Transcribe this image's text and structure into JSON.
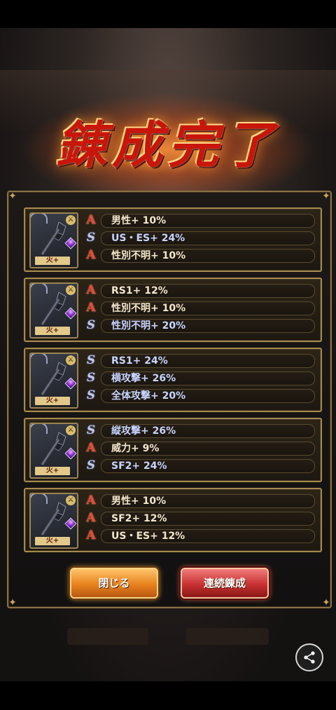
{
  "title": "錬成完了",
  "cards": [
    {
      "weapon_tag": "火+",
      "effects": [
        {
          "kind": "A",
          "text": "男性+ 10%"
        },
        {
          "kind": "S",
          "text": "US・ES+ 24%"
        },
        {
          "kind": "A",
          "text": "性別不明+ 10%"
        }
      ]
    },
    {
      "weapon_tag": "火+",
      "effects": [
        {
          "kind": "A",
          "text": "RS1+ 12%"
        },
        {
          "kind": "A",
          "text": "性別不明+ 10%"
        },
        {
          "kind": "S",
          "text": "性別不明+ 20%"
        }
      ]
    },
    {
      "weapon_tag": "火+",
      "effects": [
        {
          "kind": "S",
          "text": "RS1+ 24%"
        },
        {
          "kind": "S",
          "text": "横攻撃+ 26%"
        },
        {
          "kind": "S",
          "text": "全体攻撃+ 20%"
        }
      ]
    },
    {
      "weapon_tag": "火+",
      "effects": [
        {
          "kind": "S",
          "text": "縦攻撃+ 26%"
        },
        {
          "kind": "A",
          "text": "威力+ 9%"
        },
        {
          "kind": "S",
          "text": "SF2+ 24%"
        }
      ]
    },
    {
      "weapon_tag": "火+",
      "effects": [
        {
          "kind": "A",
          "text": "男性+ 10%"
        },
        {
          "kind": "A",
          "text": "SF2+ 12%"
        },
        {
          "kind": "A",
          "text": "US・ES+ 12%"
        }
      ]
    }
  ],
  "buttons": {
    "close": "閉じる",
    "continue": "連続錬成"
  },
  "icons": {
    "share": "share-icon",
    "weapon": "axe-icon"
  },
  "colors": {
    "rank_a": "#e94a3a",
    "rank_s": "#c3c9e8",
    "frame_gold": "#a48a4f"
  }
}
